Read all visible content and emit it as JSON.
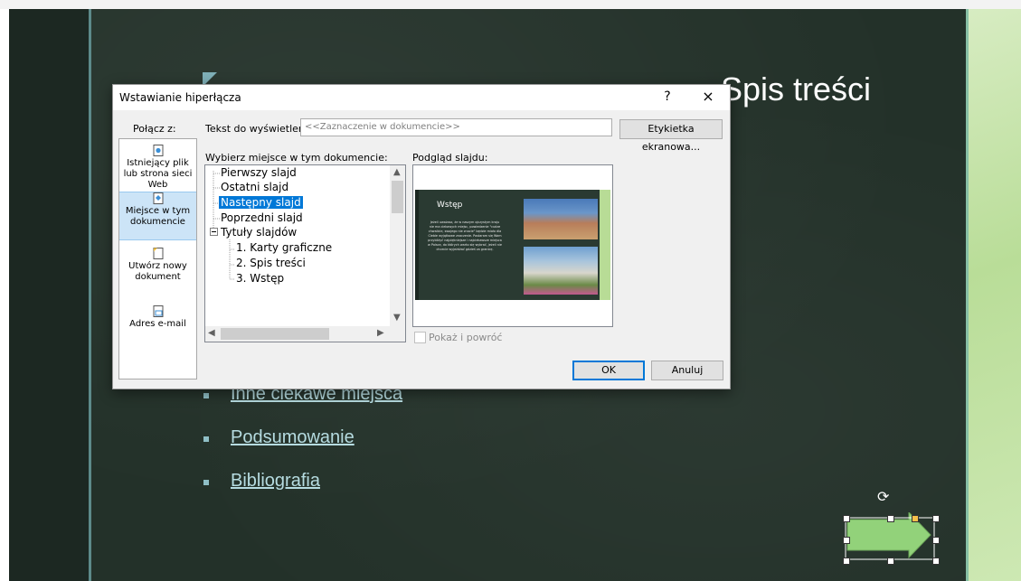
{
  "slide": {
    "title": "Spis treści",
    "list_items": [
      "Inne ciekawe miejsca",
      "Podsumowanie",
      "Bibliografia"
    ]
  },
  "dialog": {
    "title": "Wstawianie hiperłącza",
    "help": "?",
    "close": "×",
    "link_to_label": "Połącz z:",
    "display_text_label": "Tekst do wyświetlenia:",
    "display_text_value": "<<Zaznaczenie w dokumencie>>",
    "screen_tip_button": "Etykietka ekranowa...",
    "link_options": [
      {
        "label": "Istniejący plik lub strona sieci Web",
        "icon": "file-web-icon"
      },
      {
        "label": "Miejsce w tym dokumencie",
        "icon": "document-place-icon",
        "selected": true
      },
      {
        "label": "Utwórz nowy dokument",
        "icon": "new-document-icon"
      },
      {
        "label": "Adres e-mail",
        "icon": "email-icon"
      }
    ],
    "place_label": "Wybierz miejsce w tym dokumencie:",
    "tree": {
      "first": "Pierwszy slajd",
      "last": "Ostatni slajd",
      "next": "Następny slajd",
      "previous": "Poprzedni slajd",
      "titles": "Tytuły slajdów",
      "t1": "1. Karty graficzne",
      "t2": "2. Spis treści",
      "t3": "3. Wstęp"
    },
    "selected_place": "Następny slajd",
    "preview_label": "Podgląd slajdu:",
    "preview": {
      "title": "Wstęp",
      "text": "Jeżeli uważasz, że w naszym ojczystym kraju nie ma ciekawych miejsc, powiedzenie \"cudze chwalicie, swojego nie znacie\" będzie miało dla Ciebie wyjątkowe znaczenie. Postaram się Wam przybliżyć najpiękniejsze i najciekawsze miejsca w Polsce, do których warto się wybrać, jeżeli nie chcecie wyjeżdżać gdzieś za granicę."
    },
    "show_and_return": "Pokaż i powróć",
    "ok": "OK",
    "cancel": "Anuluj"
  },
  "colors": {
    "slide_bg": "#233129",
    "accent_link": "#b6dce1",
    "selection": "#0078d7",
    "arrow_fill": "#92d27a"
  }
}
